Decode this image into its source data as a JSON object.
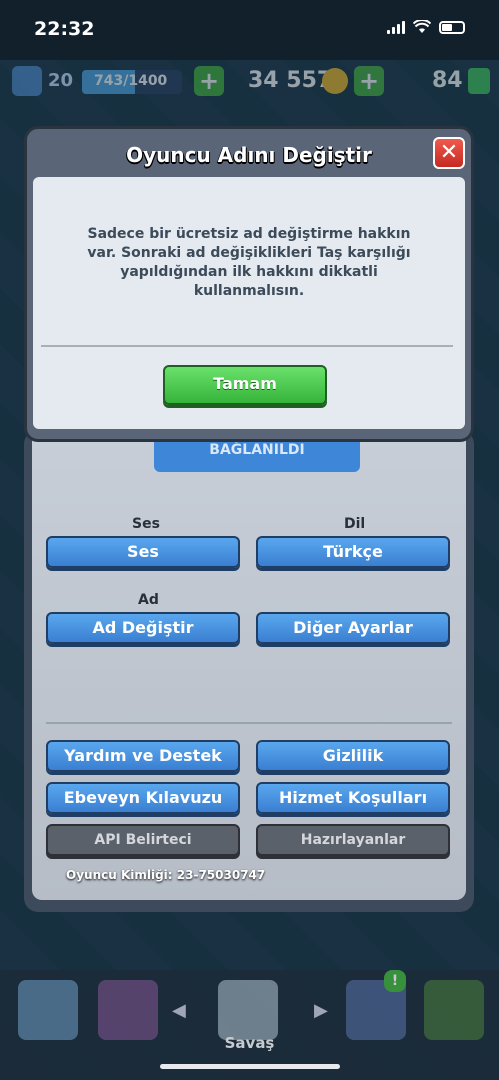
{
  "status_bar": {
    "time": "22:32"
  },
  "top_bar": {
    "level": "20",
    "xp": "743/1400",
    "xp_progress": 0.53,
    "gold": "34 557",
    "gems": "84"
  },
  "settings": {
    "linked_label": "BAĞLANILDI",
    "sound_label": "Ses",
    "sound_button": "Ses",
    "language_label": "Dil",
    "language_button": "Türkçe",
    "name_label": "Ad",
    "change_name_button": "Ad Değiştir",
    "other_settings_button": "Diğer Ayarlar",
    "help_button": "Yardım ve Destek",
    "privacy_button": "Gizlilik",
    "parent_guide_button": "Ebeveyn Kılavuzu",
    "terms_button": "Hizmet Koşulları",
    "api_button": "API Belirteci",
    "credits_button": "Hazırlayanlar",
    "player_id": "Oyuncu Kimliği: 23-75030747"
  },
  "modal": {
    "title": "Oyuncu Adını Değiştir",
    "close": "✕",
    "message": "Sadece bir ücretsiz ad değiştirme hakkın var. Sonraki ad değişiklikleri Taş karşılığı yapıldığından ilk hakkını dikkatli kullanmalısın.",
    "ok_button": "Tamam"
  },
  "bottom_nav": {
    "active_label": "Savaş",
    "notification_badge": "!"
  },
  "colors": {
    "green": "#43b03a",
    "blue": "#3a7fd2",
    "red": "#c42a22"
  }
}
